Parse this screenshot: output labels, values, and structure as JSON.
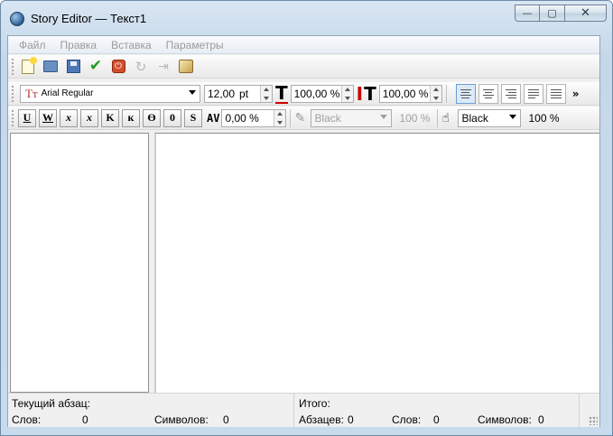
{
  "window": {
    "title": "Story Editor — Текст1",
    "minimize_glyph": "—",
    "maximize_glyph": "▢",
    "close_glyph": "✕"
  },
  "menu": [
    "Файл",
    "Правка",
    "Вставка",
    "Параметры"
  ],
  "toolbar_main": {
    "icons": [
      "new-document-icon",
      "open-icon",
      "save-icon",
      "check-icon",
      "cancel-icon",
      "refresh-icon",
      "redo-icon",
      "edit-icon"
    ]
  },
  "toolbar_font": {
    "font_glyph": "Tт",
    "font_name": "Arial Regular",
    "size_value": "12,00",
    "size_unit": "pt",
    "scale_h_value": "100,00 %",
    "scale_v_value": "100,00 %",
    "more_glyph": "»"
  },
  "toolbar_style": {
    "buttons": [
      "U",
      "W",
      "x",
      "x",
      "K",
      "к",
      "Ө",
      "0",
      "S"
    ],
    "kerning_glyph": "AV",
    "kerning_value": "0,00 %",
    "text_color": "Black",
    "text_color_shade": "100 %",
    "bg_color": "Black",
    "bg_color_shade": "100 %"
  },
  "status": {
    "current_paragraph_label": "Текущий абзац:",
    "words_label": "Слов:",
    "words_value": "0",
    "chars_label": "Символов:",
    "chars_value": "0",
    "total_label": "Итого:",
    "paragraphs_label": "Абзацев:",
    "paragraphs_value": "0",
    "total_words_label": "Слов:",
    "total_words_value": "0",
    "total_chars_label": "Символов:",
    "total_chars_value": "0"
  },
  "colors": {
    "accent": "#6d9ed3",
    "check": "#1f9e1f",
    "cancel": "#d34d2a"
  }
}
